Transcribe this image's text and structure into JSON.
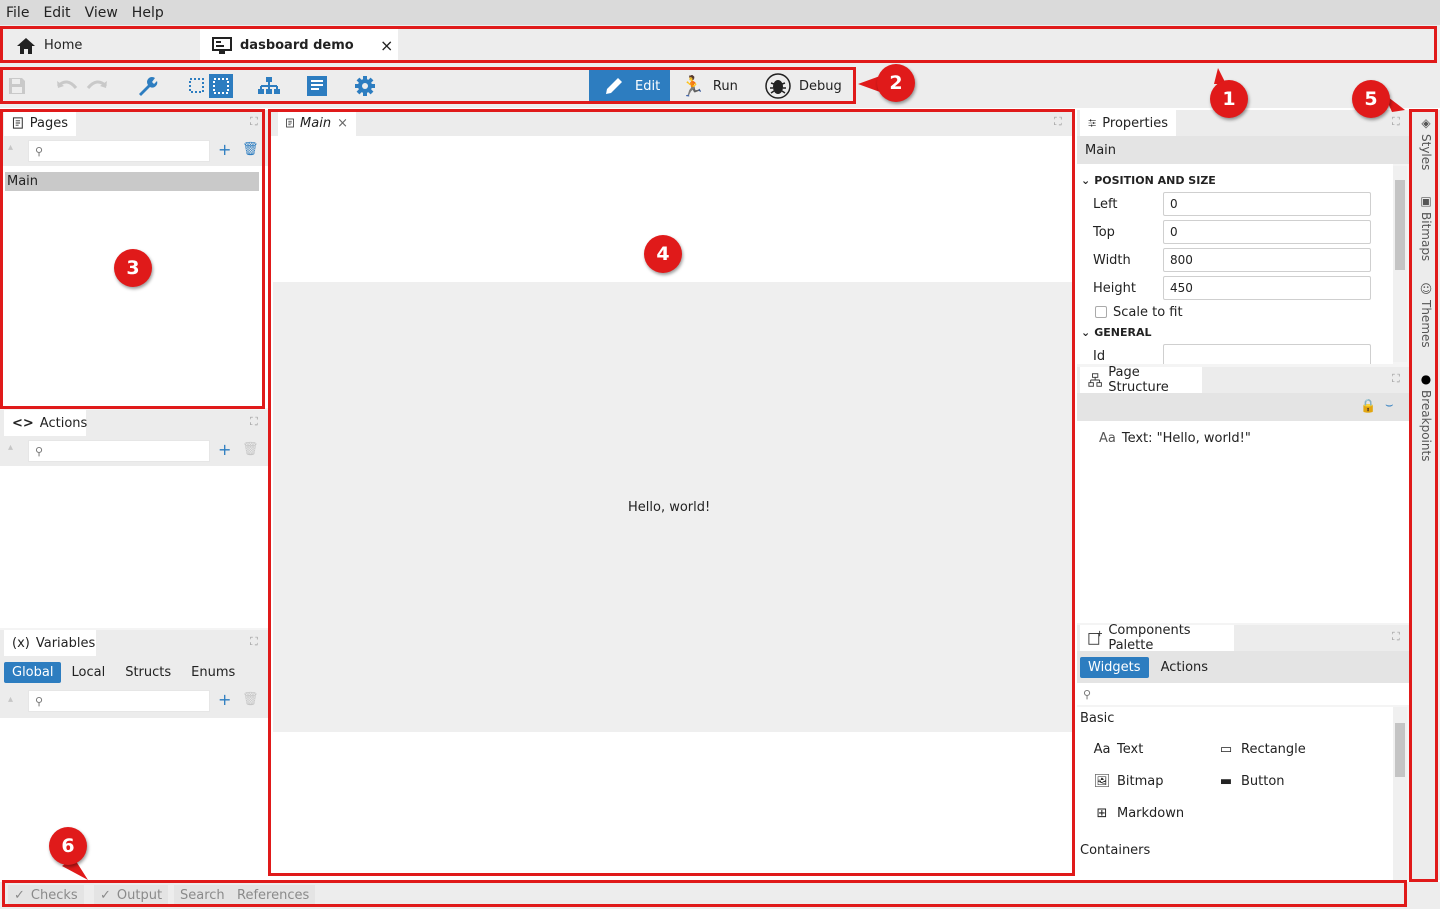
{
  "menubar": {
    "items": [
      "File",
      "Edit",
      "View",
      "Help"
    ]
  },
  "tabs": [
    {
      "label": "Home"
    },
    {
      "label": "dasboard demo",
      "close": "×"
    }
  ],
  "toolbar": {
    "modes": {
      "edit": "Edit",
      "run": "Run",
      "debug": "Debug"
    }
  },
  "pages_panel": {
    "title": "Pages",
    "search_placeholder": "",
    "items": [
      "Main"
    ]
  },
  "actions_panel": {
    "title": "Actions"
  },
  "variables_panel": {
    "title": "Variables",
    "tabs": [
      "Global",
      "Local",
      "Structs",
      "Enums"
    ]
  },
  "editor": {
    "tab_label": "Main",
    "tab_close": "×",
    "canvas_text": "Hello, world!"
  },
  "properties": {
    "title": "Properties",
    "object": "Main",
    "section_position": "POSITION AND SIZE",
    "fields": [
      {
        "label": "Left",
        "value": "0"
      },
      {
        "label": "Top",
        "value": "0"
      },
      {
        "label": "Width",
        "value": "800"
      },
      {
        "label": "Height",
        "value": "450"
      }
    ],
    "scale_label": "Scale to fit",
    "section_general": "GENERAL",
    "id_label": "Id",
    "id_value": ""
  },
  "page_structure": {
    "title": "Page Structure",
    "items": [
      "Text: \"Hello, world!\""
    ]
  },
  "components": {
    "title": "Components Palette",
    "tabs": [
      "Widgets",
      "Actions"
    ],
    "group_basic": "Basic",
    "basic": [
      "Text",
      "Rectangle",
      "Bitmap",
      "Button",
      "Markdown"
    ],
    "group_containers": "Containers"
  },
  "side_tabs": [
    "Styles",
    "Bitmaps",
    "Themes",
    "Breakpoints"
  ],
  "bottom_tabs": [
    "Checks",
    "Output",
    "Search",
    "References"
  ],
  "callouts": [
    "1",
    "2",
    "3",
    "4",
    "5",
    "6"
  ],
  "colors": {
    "accent": "#2d7dc0",
    "annotation": "#e01a1a"
  }
}
